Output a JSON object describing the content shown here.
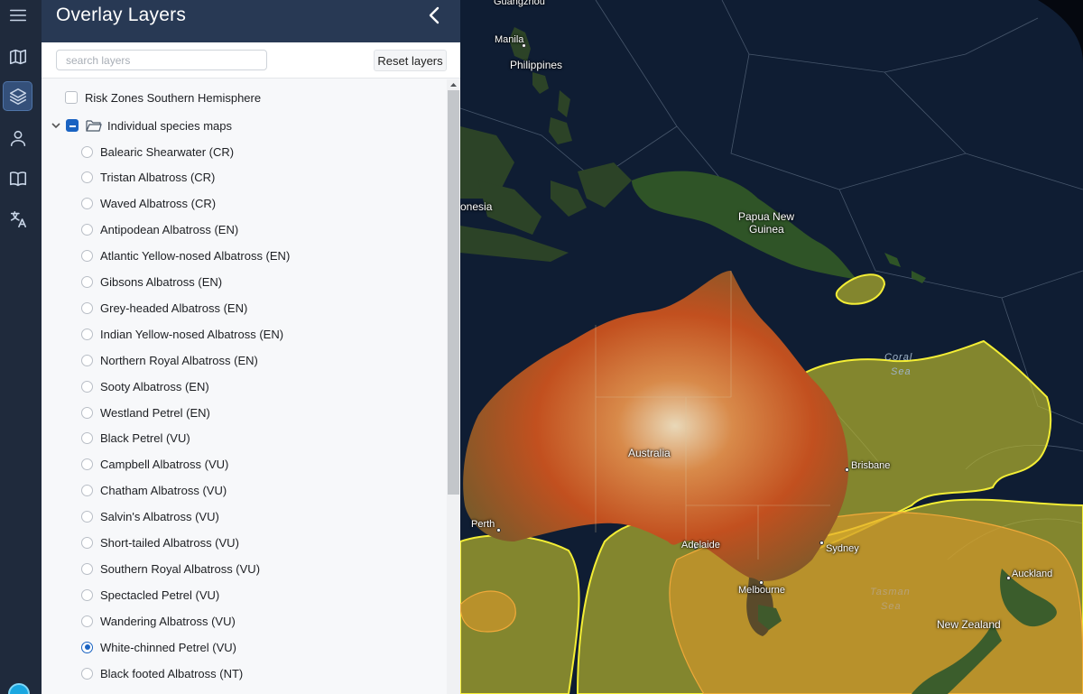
{
  "rail": {
    "items": [
      {
        "name": "menu-icon",
        "active": false
      },
      {
        "name": "map-icon",
        "active": false
      },
      {
        "name": "layers-icon",
        "active": true
      },
      {
        "name": "user-icon",
        "active": false
      },
      {
        "name": "book-icon",
        "active": false
      },
      {
        "name": "translate-icon",
        "active": false
      }
    ]
  },
  "panel": {
    "title": "Overlay Layers",
    "search_placeholder": "search layers",
    "reset_label": "Reset layers",
    "top_layer": "Risk Zones Southern Hemisphere",
    "group_label": "Individual species maps",
    "species": [
      {
        "label": "Balearic Shearwater (CR)",
        "checked": false
      },
      {
        "label": "Tristan Albatross (CR)",
        "checked": false
      },
      {
        "label": "Waved Albatross (CR)",
        "checked": false
      },
      {
        "label": "Antipodean Albatross (EN)",
        "checked": false
      },
      {
        "label": "Atlantic Yellow-nosed Albatross (EN)",
        "checked": false
      },
      {
        "label": "Gibsons Albatross (EN)",
        "checked": false
      },
      {
        "label": "Grey-headed Albatross (EN)",
        "checked": false
      },
      {
        "label": "Indian Yellow-nosed Albatross (EN)",
        "checked": false
      },
      {
        "label": "Northern Royal Albatross (EN)",
        "checked": false
      },
      {
        "label": "Sooty Albatross (EN)",
        "checked": false
      },
      {
        "label": "Westland Petrel (EN)",
        "checked": false
      },
      {
        "label": "Black Petrel (VU)",
        "checked": false
      },
      {
        "label": "Campbell Albatross (VU)",
        "checked": false
      },
      {
        "label": "Chatham Albatross (VU)",
        "checked": false
      },
      {
        "label": "Salvin's Albatross (VU)",
        "checked": false
      },
      {
        "label": "Short-tailed Albatross (VU)",
        "checked": false
      },
      {
        "label": "Southern Royal Albatross (VU)",
        "checked": false
      },
      {
        "label": "Spectacled Petrel (VU)",
        "checked": false
      },
      {
        "label": "Wandering Albatross (VU)",
        "checked": false
      },
      {
        "label": "White-chinned Petrel (VU)",
        "checked": true
      },
      {
        "label": "Black footed Albatross (NT)",
        "checked": false
      }
    ]
  },
  "map": {
    "labels": {
      "guangzhou": "Guangzhou",
      "manila": "Manila",
      "philippines": "Philippines",
      "indonesia": "onesia",
      "png1": "Papua New",
      "png2": "Guinea",
      "coral1": "Coral",
      "coral2": "Sea",
      "australia": "Australia",
      "brisbane": "Brisbane",
      "perth": "Perth",
      "adelaide": "Adelaide",
      "sydney": "Sydney",
      "melbourne": "Melbourne",
      "tasman1": "Tasman",
      "tasman2": "Sea",
      "auckland": "Auckland",
      "nz": "New Zealand"
    },
    "colors": {
      "ocean": "#0d1a2e",
      "land": "#2f4a2a",
      "australia_hot": "#c2501f",
      "zone_yellow": "#c9c42a",
      "zone_orange": "#e49a2a",
      "outline": "#f4ee35"
    }
  }
}
